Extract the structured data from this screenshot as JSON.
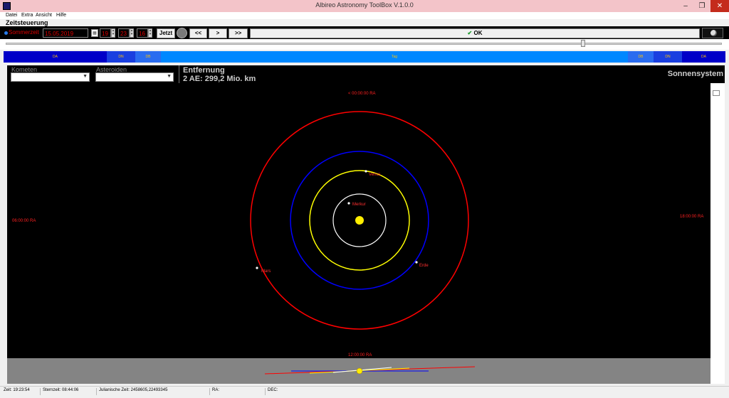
{
  "window": {
    "title": "Albireo Astronomy ToolBox V.1.0.0"
  },
  "menu": {
    "items": [
      "Datei",
      "Extra",
      "Ansicht",
      "Hilfe"
    ]
  },
  "zeitsteuerung": {
    "section_label": "Zeitsteuerung",
    "dst_label": "Sommerzeit",
    "date": "15.05.2019",
    "hour": "19",
    "minute": "23",
    "second": "16",
    "now_label": "Jetzt",
    "back_label": "<<",
    "fwd_label": ">",
    "ffwd_label": ">>",
    "ok_label": "OK"
  },
  "daybar": {
    "segments": [
      {
        "label": "DA",
        "color": "#0000c8"
      },
      {
        "label": "DN",
        "color": "#1a3fe0"
      },
      {
        "label": "DB",
        "color": "#2a6cf0"
      },
      {
        "label": "Tag",
        "color": "#0088ff"
      },
      {
        "label": "DB",
        "color": "#2a6cf0"
      },
      {
        "label": "DN",
        "color": "#1a3fe0"
      },
      {
        "label": "DA",
        "color": "#0000c8"
      }
    ]
  },
  "selectors": {
    "kometen_label": "Kometen",
    "asteroiden_label": "Asteroiden"
  },
  "distance": {
    "title": "Entfernung",
    "value": "2 AE: 299,2 Mio. km"
  },
  "view_title": "Sonnensystem",
  "orbit_view": {
    "ra_labels": {
      "top": "< 00:00:00 RA",
      "left": "06:00:00 RA",
      "right": "18:00:00 RA",
      "bottom": "12:00:00 RA"
    },
    "planets": [
      {
        "name": "Merkur",
        "orbit_color": "#ffffff"
      },
      {
        "name": "Venus",
        "orbit_color": "#ffff00"
      },
      {
        "name": "Erde",
        "orbit_color": "#0000ff"
      },
      {
        "name": "Mars",
        "orbit_color": "#ff0000"
      }
    ],
    "sun_color": "#ffee00"
  },
  "status": {
    "zeit": "Zeit: 19:23:54",
    "sternzeit": "Sternzeit: 08:44:06",
    "julian": "Julianische Zeit: 2458605,22493345",
    "ra": "RA:",
    "dec": "DEC:"
  },
  "icons": [
    "app-icon",
    "minimize-icon",
    "maximize-icon",
    "close-icon",
    "calendar-icon",
    "moon-phase-icon",
    "check-icon",
    "dropdown-arrow-icon"
  ]
}
